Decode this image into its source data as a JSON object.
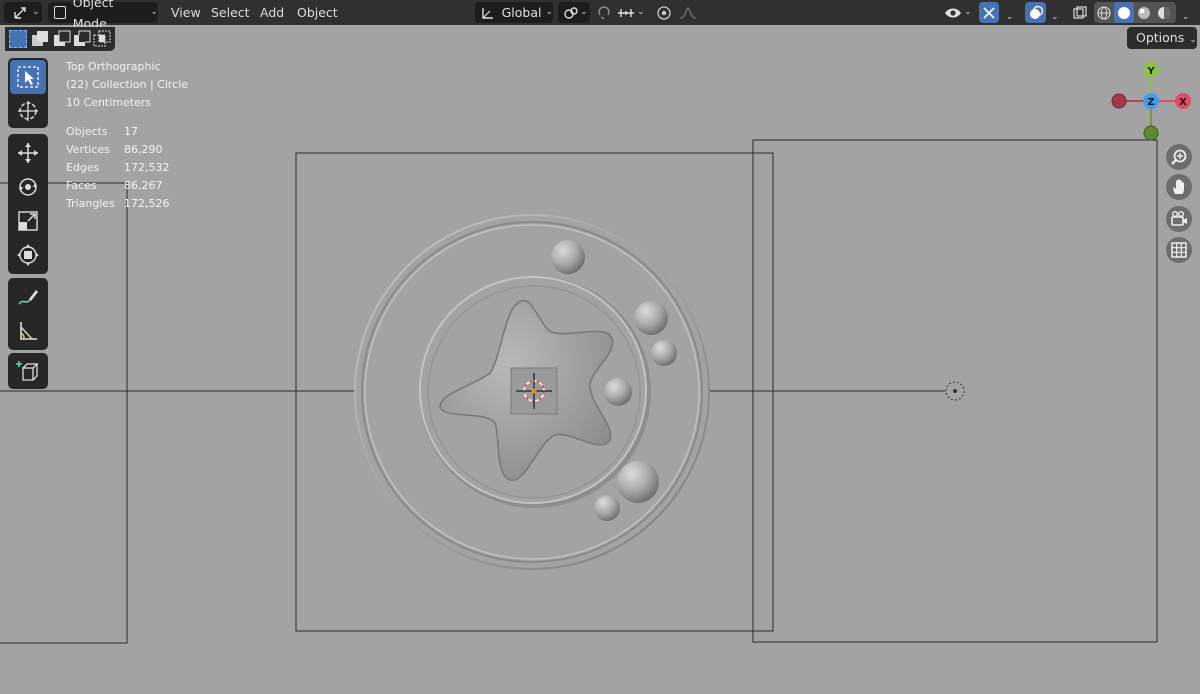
{
  "header": {
    "mode_label": "Object Mode",
    "menus": [
      "View",
      "Select",
      "Add",
      "Object"
    ],
    "transform_orientation": "Global"
  },
  "options_label": "Options",
  "viewport_info": {
    "view_name": "Top Orthographic",
    "collection": "(22) Collection | Circle",
    "scale": "10 Centimeters"
  },
  "stats": [
    {
      "label": "Objects",
      "value": "17"
    },
    {
      "label": "Vertices",
      "value": "86,290"
    },
    {
      "label": "Edges",
      "value": "172,532"
    },
    {
      "label": "Faces",
      "value": "86,267"
    },
    {
      "label": "Triangles",
      "value": "172,526"
    }
  ],
  "gizmo": {
    "y": "Y",
    "z": "Z",
    "x": "X"
  },
  "icons": {
    "editor_type": "transform-gizmo-icon",
    "tools": [
      "select-box-icon",
      "cursor-icon",
      "move-icon",
      "rotate-icon",
      "scale-icon",
      "transform-icon",
      "annotate-icon",
      "measure-icon",
      "add-cube-icon"
    ],
    "nav": [
      "zoom-icon",
      "pan-hand-icon",
      "camera-icon",
      "grid-icon"
    ]
  },
  "colors": {
    "header_bg": "#303030",
    "viewport_bg": "#a3a3a3",
    "active_blue": "#4772b3",
    "axis_x": "#e54a5f",
    "axis_y": "#8bc34a",
    "axis_z": "#3d9df3"
  }
}
